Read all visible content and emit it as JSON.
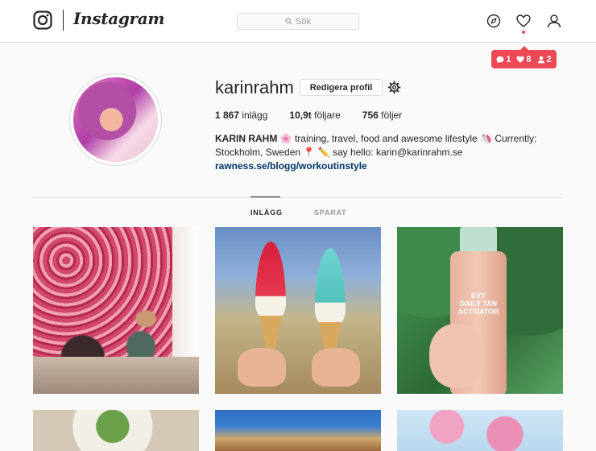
{
  "app": {
    "wordmark": "Instagram"
  },
  "search": {
    "placeholder": "Sök"
  },
  "notifications": {
    "comments": "1",
    "likes": "8",
    "followers": "2"
  },
  "profile": {
    "username": "karinrahm",
    "edit_label": "Redigera profil",
    "stats": {
      "posts_value": "1 867",
      "posts_label": "inlägg",
      "followers_value": "10,9t",
      "followers_label": "följare",
      "following_value": "756",
      "following_label": "följer"
    },
    "bio": {
      "name": "KARIN RAHM",
      "text": "🌸 training, travel, food and awesome lifestyle 🦄 Currently: Stockholm, Sweden 📍 ✏️ say hello: karin@karinrahm.se",
      "link": "rawness.se/blogg/workoutinstyle"
    }
  },
  "tabs": [
    {
      "label": "INLÄGG",
      "active": true
    },
    {
      "label": "SPARAT",
      "active": false
    }
  ],
  "posts": [
    {
      "subject": "flower-wall"
    },
    {
      "subject": "ice-creams"
    },
    {
      "subject": "evy-bottle",
      "text": "EVY\nDAILY TAN\nACTIVATOR"
    },
    {
      "subject": "food-plate"
    },
    {
      "subject": "city-buildings"
    },
    {
      "subject": "cherry-blossom"
    }
  ],
  "colors": {
    "accent": "#ed4956",
    "link": "#003569",
    "border": "#dbdbdb"
  }
}
